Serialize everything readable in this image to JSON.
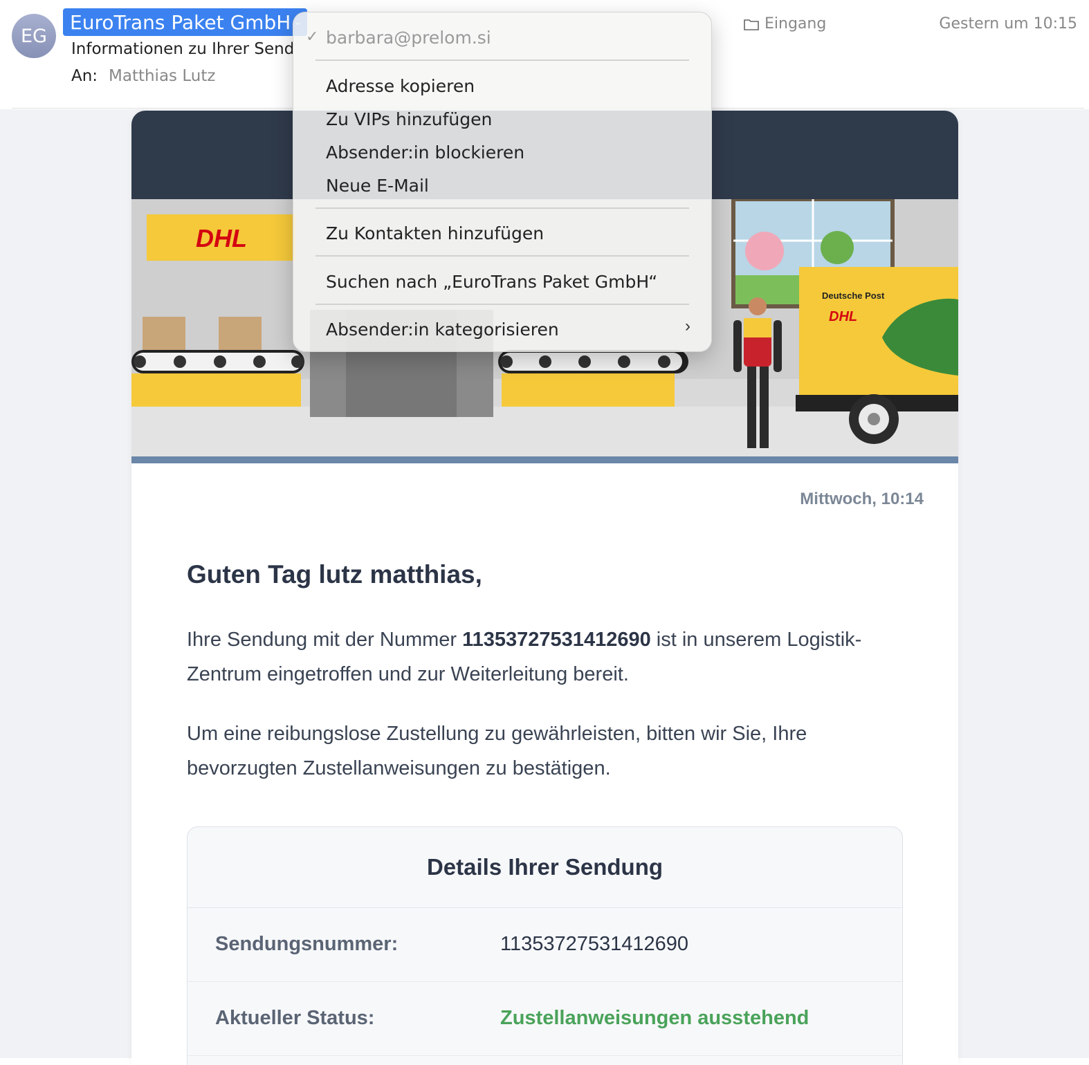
{
  "header": {
    "avatar_initials": "EG",
    "sender_name": "EuroTrans Paket GmbH",
    "subject": "Informationen zu Ihrer Sendung",
    "to_label": "An:",
    "to_name": "Matthias Lutz",
    "mailbox": "Eingang",
    "date": "Gestern um 10:15"
  },
  "menu": {
    "email": "barbara@prelom.si",
    "check": "✓",
    "items": [
      "Adresse kopieren",
      "Zu VIPs hinzufügen",
      "Absender:in blockieren",
      "Neue E-Mail",
      "Zu Kontakten hinzufügen",
      "Suchen nach „EuroTrans Paket GmbH“",
      "Absender:in kategorisieren"
    ]
  },
  "email": {
    "banner_logo_text": "DHL",
    "truck_brand": "Deutsche Post",
    "timestamp": "Mittwoch, 10:14",
    "greeting": "Guten Tag lutz matthias,",
    "para1_before": "Ihre Sendung mit der Nummer ",
    "para1_number": "11353727531412690",
    "para1_after": " ist in unserem Logistik-Zentrum eingetroffen und zur Weiterleitung bereit.",
    "para2": "Um eine reibungslose Zustellung zu gewährleisten, bitten wir Sie, Ihre bevorzugten Zustellanweisungen zu bestätigen.",
    "details_title": "Details Ihrer Sendung",
    "rows": [
      {
        "label": "Sendungsnummer:",
        "value": "11353727531412690"
      },
      {
        "label": "Aktueller Status:",
        "value": "Zustellanweisungen ausstehend"
      }
    ]
  },
  "colors": {
    "sender_chip": "#3b82f0",
    "banner_dark": "#2f3a4b",
    "dhl_yellow": "#f5c93a",
    "dhl_red": "#d40511",
    "status_green": "#4aa35a"
  }
}
